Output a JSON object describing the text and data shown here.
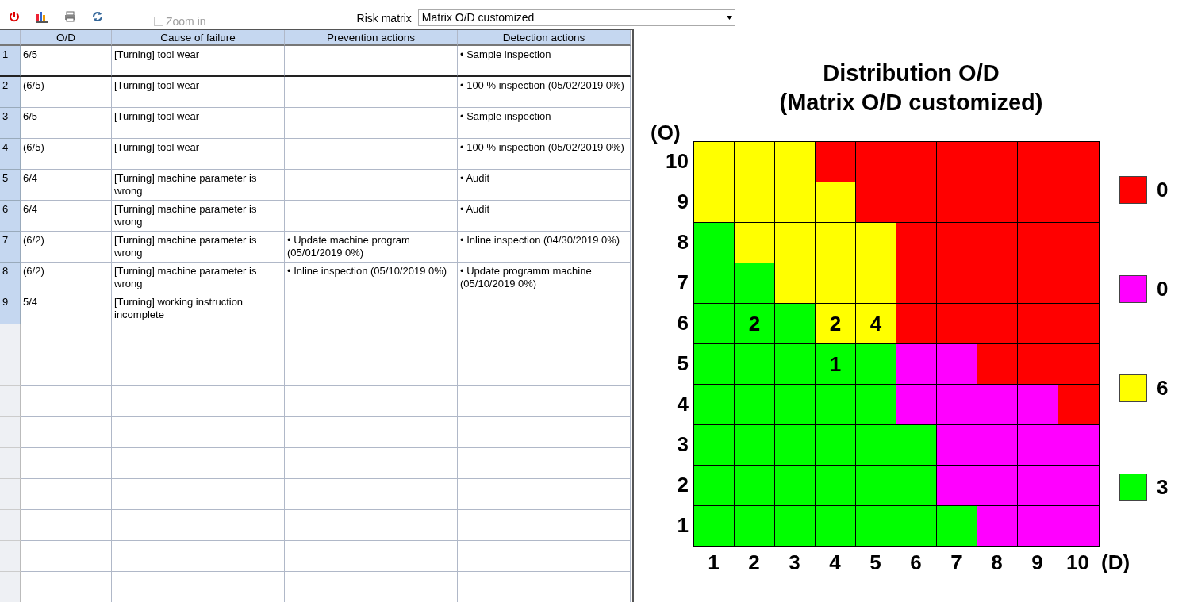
{
  "toolbar": {
    "zoom_in": {
      "label": "Zoom in",
      "checked": false,
      "disabled": true
    },
    "risk_matrix": {
      "label": "Risk matrix",
      "value": "Matrix O/D customized"
    }
  },
  "table": {
    "columns": [
      "",
      "O/D",
      "Cause of failure",
      "Prevention actions",
      "Detection actions"
    ],
    "rows": [
      {
        "number": "1",
        "od": "6/5",
        "cause": "[Turning] tool wear",
        "prevention": "",
        "detection": "• Sample inspection",
        "group_end": true
      },
      {
        "number": "2",
        "od": "(6/5)",
        "cause": "[Turning] tool wear",
        "prevention": "",
        "detection": "• 100 % inspection (05/02/2019 0%)",
        "group_end": false
      },
      {
        "number": "3",
        "od": "6/5",
        "cause": "[Turning] tool wear",
        "prevention": "",
        "detection": "• Sample inspection",
        "group_end": false
      },
      {
        "number": "4",
        "od": "(6/5)",
        "cause": "[Turning] tool wear",
        "prevention": "",
        "detection": "• 100 % inspection (05/02/2019 0%)",
        "group_end": false
      },
      {
        "number": "5",
        "od": "6/4",
        "cause": "[Turning] machine parameter is wrong",
        "prevention": "",
        "detection": "• Audit",
        "group_end": false
      },
      {
        "number": "6",
        "od": "6/4",
        "cause": "[Turning] machine parameter is wrong",
        "prevention": "",
        "detection": "• Audit",
        "group_end": false
      },
      {
        "number": "7",
        "od": "(6/2)",
        "cause": "[Turning] machine parameter is wrong",
        "prevention": "• Update machine program (05/01/2019 0%)",
        "detection": "• Inline inspection (04/30/2019 0%)",
        "group_end": false
      },
      {
        "number": "8",
        "od": "(6/2)",
        "cause": "[Turning] machine parameter is wrong",
        "prevention": "• Inline inspection (05/10/2019 0%)",
        "detection": "• Update programm machine (05/10/2019 0%)",
        "group_end": false
      },
      {
        "number": "9",
        "od": "5/4",
        "cause": "[Turning] working instruction incomplete",
        "prevention": "",
        "detection": "",
        "group_end": false
      }
    ]
  },
  "matrix": {
    "title": "Distribution O/D",
    "subtitle": "(Matrix O/D customized)",
    "y_axis_label": "(O)",
    "x_axis_label": "(D)",
    "x_labels": [
      "1",
      "2",
      "3",
      "4",
      "5",
      "6",
      "7",
      "8",
      "9",
      "10"
    ],
    "rows": [
      {
        "label": "10",
        "cells": [
          {
            "color": "#ffff00"
          },
          {
            "color": "#ffff00"
          },
          {
            "color": "#ffff00"
          },
          {
            "color": "#ff0000"
          },
          {
            "color": "#ff0000"
          },
          {
            "color": "#ff0000"
          },
          {
            "color": "#ff0000"
          },
          {
            "color": "#ff0000"
          },
          {
            "color": "#ff0000"
          },
          {
            "color": "#ff0000"
          }
        ]
      },
      {
        "label": "9",
        "cells": [
          {
            "color": "#ffff00"
          },
          {
            "color": "#ffff00"
          },
          {
            "color": "#ffff00"
          },
          {
            "color": "#ffff00"
          },
          {
            "color": "#ff0000"
          },
          {
            "color": "#ff0000"
          },
          {
            "color": "#ff0000"
          },
          {
            "color": "#ff0000"
          },
          {
            "color": "#ff0000"
          },
          {
            "color": "#ff0000"
          }
        ]
      },
      {
        "label": "8",
        "cells": [
          {
            "color": "#00ff00"
          },
          {
            "color": "#ffff00"
          },
          {
            "color": "#ffff00"
          },
          {
            "color": "#ffff00"
          },
          {
            "color": "#ffff00"
          },
          {
            "color": "#ff0000"
          },
          {
            "color": "#ff0000"
          },
          {
            "color": "#ff0000"
          },
          {
            "color": "#ff0000"
          },
          {
            "color": "#ff0000"
          }
        ]
      },
      {
        "label": "7",
        "cells": [
          {
            "color": "#00ff00"
          },
          {
            "color": "#00ff00"
          },
          {
            "color": "#ffff00"
          },
          {
            "color": "#ffff00"
          },
          {
            "color": "#ffff00"
          },
          {
            "color": "#ff0000"
          },
          {
            "color": "#ff0000"
          },
          {
            "color": "#ff0000"
          },
          {
            "color": "#ff0000"
          },
          {
            "color": "#ff0000"
          }
        ]
      },
      {
        "label": "6",
        "cells": [
          {
            "color": "#00ff00"
          },
          {
            "color": "#00ff00",
            "count": "2"
          },
          {
            "color": "#00ff00"
          },
          {
            "color": "#ffff00",
            "count": "2"
          },
          {
            "color": "#ffff00",
            "count": "4"
          },
          {
            "color": "#ff0000"
          },
          {
            "color": "#ff0000"
          },
          {
            "color": "#ff0000"
          },
          {
            "color": "#ff0000"
          },
          {
            "color": "#ff0000"
          }
        ]
      },
      {
        "label": "5",
        "cells": [
          {
            "color": "#00ff00"
          },
          {
            "color": "#00ff00"
          },
          {
            "color": "#00ff00"
          },
          {
            "color": "#00ff00",
            "count": "1"
          },
          {
            "color": "#00ff00"
          },
          {
            "color": "#ff00ff"
          },
          {
            "color": "#ff00ff"
          },
          {
            "color": "#ff0000"
          },
          {
            "color": "#ff0000"
          },
          {
            "color": "#ff0000"
          }
        ]
      },
      {
        "label": "4",
        "cells": [
          {
            "color": "#00ff00"
          },
          {
            "color": "#00ff00"
          },
          {
            "color": "#00ff00"
          },
          {
            "color": "#00ff00"
          },
          {
            "color": "#00ff00"
          },
          {
            "color": "#ff00ff"
          },
          {
            "color": "#ff00ff"
          },
          {
            "color": "#ff00ff"
          },
          {
            "color": "#ff00ff"
          },
          {
            "color": "#ff0000"
          }
        ]
      },
      {
        "label": "3",
        "cells": [
          {
            "color": "#00ff00"
          },
          {
            "color": "#00ff00"
          },
          {
            "color": "#00ff00"
          },
          {
            "color": "#00ff00"
          },
          {
            "color": "#00ff00"
          },
          {
            "color": "#00ff00"
          },
          {
            "color": "#ff00ff"
          },
          {
            "color": "#ff00ff"
          },
          {
            "color": "#ff00ff"
          },
          {
            "color": "#ff00ff"
          }
        ]
      },
      {
        "label": "2",
        "cells": [
          {
            "color": "#00ff00"
          },
          {
            "color": "#00ff00"
          },
          {
            "color": "#00ff00"
          },
          {
            "color": "#00ff00"
          },
          {
            "color": "#00ff00"
          },
          {
            "color": "#00ff00"
          },
          {
            "color": "#ff00ff"
          },
          {
            "color": "#ff00ff"
          },
          {
            "color": "#ff00ff"
          },
          {
            "color": "#ff00ff"
          }
        ]
      },
      {
        "label": "1",
        "cells": [
          {
            "color": "#00ff00"
          },
          {
            "color": "#00ff00"
          },
          {
            "color": "#00ff00"
          },
          {
            "color": "#00ff00"
          },
          {
            "color": "#00ff00"
          },
          {
            "color": "#00ff00"
          },
          {
            "color": "#00ff00"
          },
          {
            "color": "#ff00ff"
          },
          {
            "color": "#ff00ff"
          },
          {
            "color": "#ff00ff"
          }
        ]
      }
    ],
    "legend": [
      {
        "color": "#ff0000",
        "value": "0"
      },
      {
        "color": "#ff00ff",
        "value": "0"
      },
      {
        "color": "#ffff00",
        "value": "6"
      },
      {
        "color": "#00ff00",
        "value": "3"
      }
    ]
  }
}
